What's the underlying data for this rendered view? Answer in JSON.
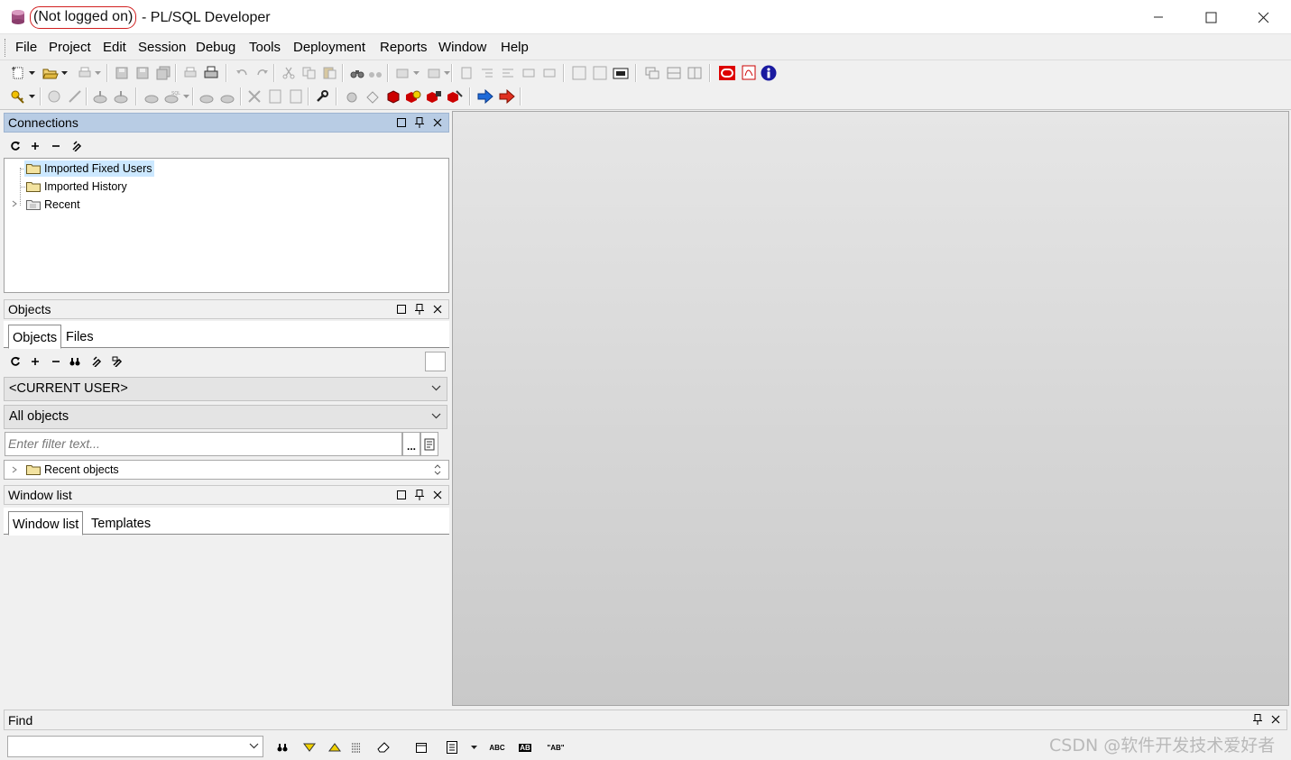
{
  "window": {
    "status": "(Not logged on)",
    "title_rest": "- PL/SQL Developer"
  },
  "menu": [
    "File",
    "Project",
    "Edit",
    "Session",
    "Debug",
    "Tools",
    "Deployment",
    "Reports",
    "Window",
    "Help"
  ],
  "connections": {
    "title": "Connections",
    "items": [
      "Imported Fixed Users",
      "Imported History",
      "Recent"
    ]
  },
  "objects": {
    "title": "Objects",
    "tabs": [
      "Objects",
      "Files"
    ],
    "user_select": "<CURRENT USER>",
    "type_select": "All objects",
    "filter_placeholder": "Enter filter text...",
    "more_button": "...",
    "recent": "Recent objects"
  },
  "windowlist": {
    "title": "Window list",
    "tabs": [
      "Window list",
      "Templates"
    ]
  },
  "find": {
    "title": "Find",
    "icons": [
      "find-icon",
      "find-next-icon",
      "find-previous-icon",
      "highlight-all-icon",
      "clear-icon",
      "window-icon",
      "document-icon",
      "match-case-icon",
      "whole-word-icon",
      "quoted-icon"
    ],
    "match_case_label": "ABC",
    "word_label": "AB",
    "quote_label": "\"AB\""
  },
  "watermark": "CSDN @软件开发技术爱好者",
  "colors": {
    "active_header": "#b8cce4",
    "title_highlight_border": "#d12020",
    "mdi_top": "#e6e6e6",
    "mdi_bottom": "#c9c9c9"
  }
}
